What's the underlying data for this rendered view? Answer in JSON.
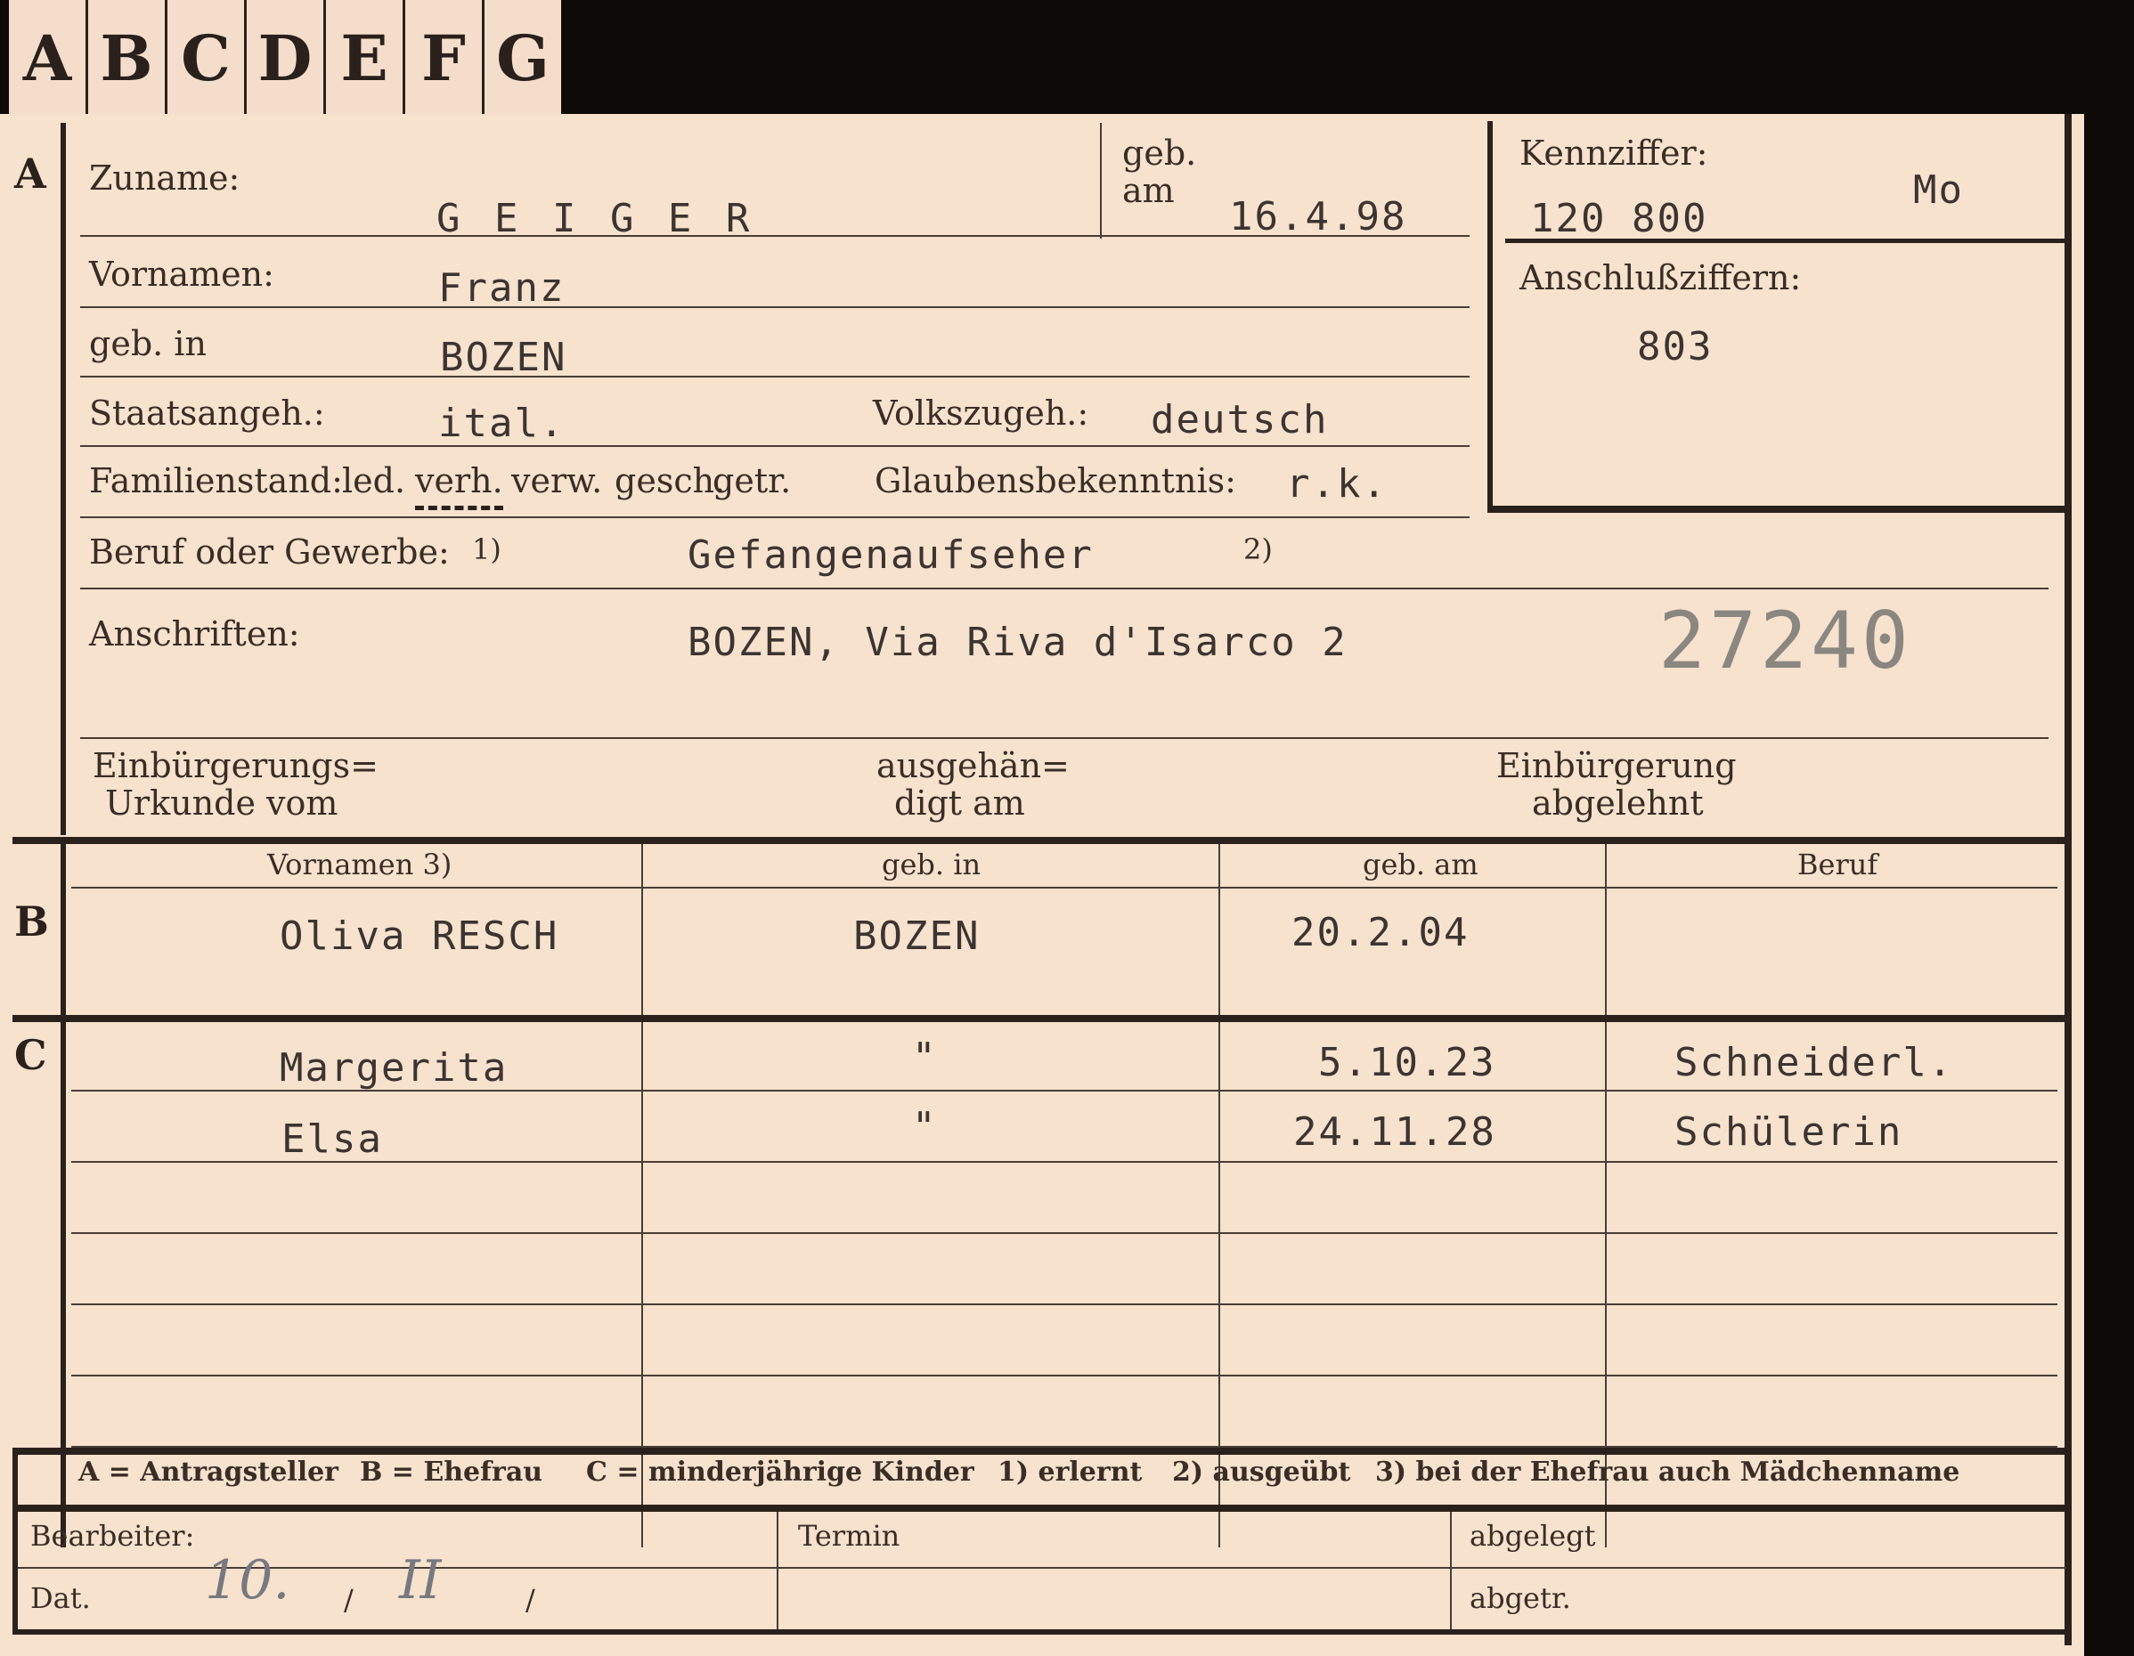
{
  "tabs": [
    "A",
    "B",
    "C",
    "D",
    "E",
    "F",
    "G"
  ],
  "section_a": {
    "marker": "A",
    "zuname_label": "Zuname:",
    "zuname": "G E I G E R",
    "geb_label_1": "geb.",
    "geb_label_2": "am",
    "geb_am": "16.4.98",
    "kennziffer_label": "Kennziffer:",
    "kennziffer": "120 800",
    "kennziffer_code": "Mo",
    "vornamen_label": "Vornamen:",
    "vornamen": "Franz",
    "anschluss_label": "Anschlußziffern:",
    "anschluss": "803",
    "geb_in_label": "geb. in",
    "geb_in": "BOZEN",
    "staats_label": "Staatsangeh.:",
    "staats": "ital.",
    "volks_label": "Volkszugeh.:",
    "volks": "deutsch",
    "familien_label": "Familienstand:",
    "familien_options": [
      "led.",
      "verh.",
      "verw.",
      "gesch.",
      "getr."
    ],
    "familien_selected": "verh.",
    "glauben_label": "Glaubensbekenntnis:",
    "glauben": "r.k.",
    "beruf_label": "Beruf oder Gewerbe:",
    "beruf_note1": "1)",
    "beruf": "Gefangenaufseher",
    "beruf_note2": "2)",
    "anschriften_label": "Anschriften:",
    "anschrift": "BOZEN, Via Riva d'Isarco 2",
    "stamp_number": "27240",
    "einb_urkunde_1": "Einbürgerungs=",
    "einb_urkunde_2": "Urkunde vom",
    "ausgehaendigt_1": "ausgehän=",
    "ausgehaendigt_2": "digt am",
    "einb_abgelehnt_1": "Einbürgerung",
    "einb_abgelehnt_2": "abgelehnt"
  },
  "section_b": {
    "marker": "B",
    "headers": [
      "Vornamen 3)",
      "geb. in",
      "geb. am",
      "Beruf"
    ],
    "row": {
      "vornamen": "Oliva RESCH",
      "geb_in": "BOZEN",
      "geb_am": "20.2.04",
      "beruf": ""
    }
  },
  "section_c": {
    "marker": "C",
    "rows": [
      {
        "vornamen": "Margerita",
        "geb_in": "\"",
        "geb_am": "5.10.23",
        "beruf": "Schneiderl."
      },
      {
        "vornamen": "Elsa",
        "geb_in": "\"",
        "geb_am": "24.11.28",
        "beruf": "Schülerin"
      }
    ]
  },
  "legend": {
    "a": "A = Antragsteller",
    "b": "B = Ehefrau",
    "c": "C = minderjährige Kinder",
    "n1": "1) erlernt",
    "n2": "2) ausgeübt",
    "n3": "3) bei der Ehefrau auch Mädchenname"
  },
  "footer": {
    "bearbeiter_label": "Bearbeiter:",
    "dat_label": "Dat.",
    "dat_day": "10.",
    "dat_sep1": "/",
    "dat_month": "II",
    "dat_sep2": "/",
    "termin_label": "Termin",
    "abgelegt_label": "abgelegt",
    "abgetr_label": "abgetr."
  }
}
